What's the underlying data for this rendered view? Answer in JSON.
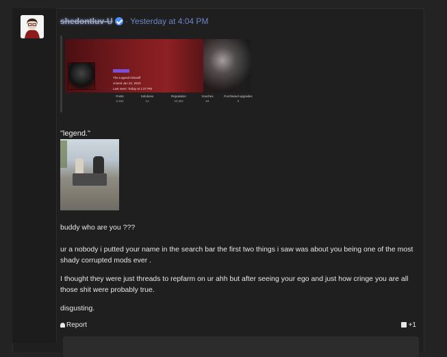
{
  "post": {
    "username": "shedontluv-U",
    "separator": "·",
    "timestamp": "Yesterday at 4:04 PM",
    "quote": {
      "banner": {
        "title_line": "The Legend Himself",
        "joined": "Joined Jan 22, 2023",
        "last_seen": "Last seen: Today at 1:27 PM"
      },
      "stats": [
        {
          "label": "Posts",
          "value": "3,462"
        },
        {
          "label": "Solutions",
          "value": "12"
        },
        {
          "label": "Reputation",
          "value": "10,352"
        },
        {
          "label": "Vouches",
          "value": "84"
        },
        {
          "label": "Purchased upgrades",
          "value": "9"
        }
      ]
    },
    "quote_text": "\"legend.\"",
    "paragraphs": [
      "buddy who are you ???",
      "ur a nobody i putted your name in the search bar the first two things i saw was about you being one of the most shady corrupted mods ever .",
      "I thought they were just threads to repfarm on ur ahh but after seeing your ego and just how cringe you are all those shit were probably true.",
      "disgusting."
    ],
    "actions": {
      "report_label": "Report",
      "like_count": "+1"
    }
  }
}
